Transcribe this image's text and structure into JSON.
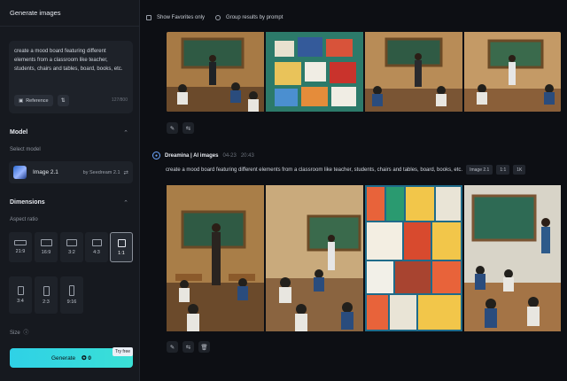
{
  "left_panel": {
    "title": "Generate images",
    "prompt": "create a mood board featuring different elements from a classroom like teacher, students, chairs and tables, board, books, etc.",
    "reference_label": "Reference",
    "char_count": "127/800",
    "model_section": "Model",
    "select_model_label": "Select model",
    "model_name": "Image 2.1",
    "model_by": "by Seedream 2.1",
    "dimensions_section": "Dimensions",
    "aspect_ratio_label": "Aspect ratio",
    "ratios": [
      "21:9",
      "16:9",
      "3:2",
      "4:3",
      "1:1",
      "3:4",
      "2:3",
      "9:16"
    ],
    "selected_ratio": "1:1",
    "size_label": "Size",
    "generate_label": "Generate",
    "generate_credits": "0",
    "try_free": "Try free"
  },
  "topbar": {
    "show_favorites": "Show Favorites only",
    "group_by_prompt": "Group results by prompt"
  },
  "generation": {
    "brand": "Dreamina | AI images",
    "date": "04-23",
    "time": "20:43",
    "prompt": "create a mood board featuring different elements from a classroom like teacher, students, chairs and tables, board, books, etc.",
    "model_tag": "Image 2.1",
    "ratio_tag": "1:1",
    "resolution_tag": "1K"
  },
  "icons": {
    "edit": "pencil-icon",
    "regenerate": "refresh-icon",
    "delete": "trash-icon",
    "reference": "image-icon",
    "swap": "swap-icon",
    "chevron": "chevron-up-icon",
    "info": "info-icon"
  },
  "colors": {
    "accent": "#33d6e2",
    "panel": "#16191f",
    "background": "#0d0f14"
  }
}
